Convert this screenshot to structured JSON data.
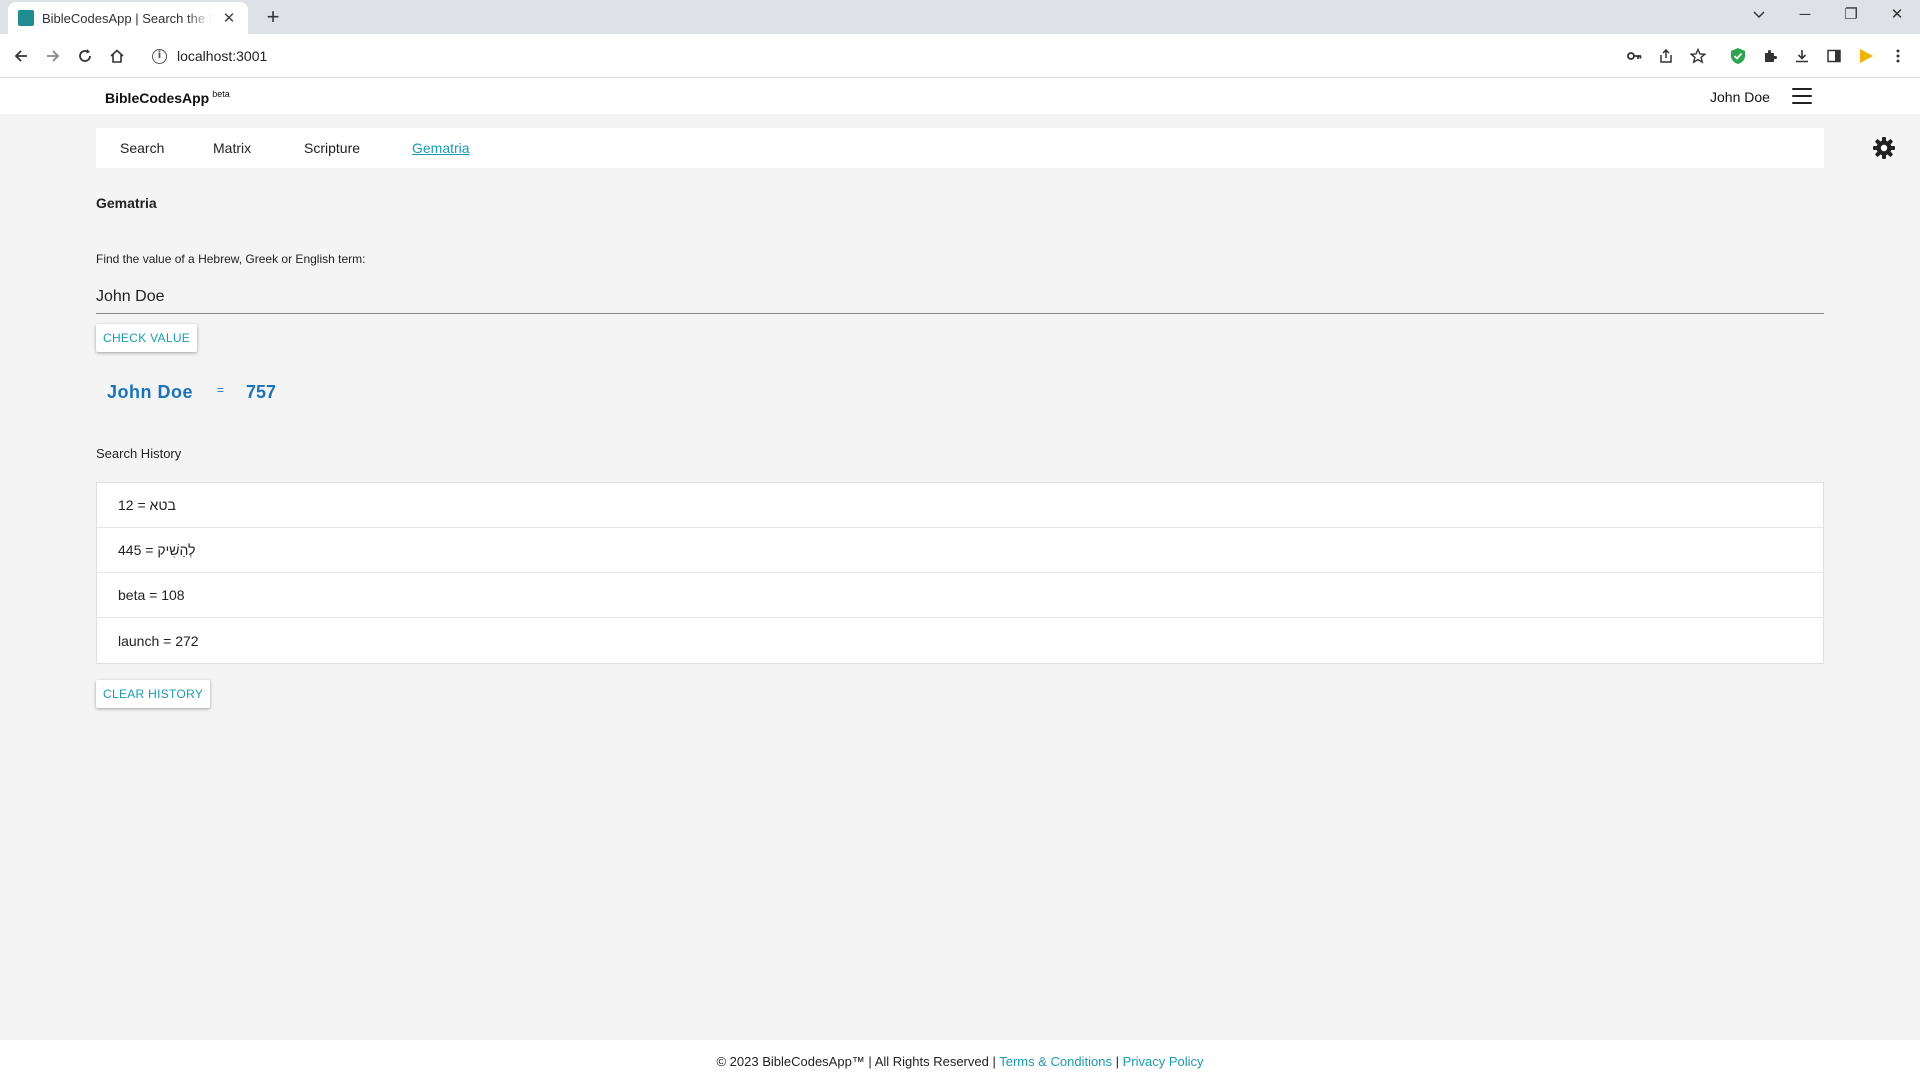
{
  "browser": {
    "tab_title": "BibleCodesApp | Search the Bible",
    "url": "localhost:3001"
  },
  "app": {
    "brand": "BibleCodesApp",
    "brand_tag": "beta",
    "user_name": "John Doe"
  },
  "nav": {
    "tabs": [
      {
        "label": "Search"
      },
      {
        "label": "Matrix"
      },
      {
        "label": "Scripture"
      },
      {
        "label": "Gematria"
      }
    ],
    "active": "Gematria"
  },
  "gematria": {
    "title": "Gematria",
    "field_label": "Find the value of a Hebrew, Greek or English term:",
    "input_value": "John Doe",
    "check_button": "CHECK VALUE",
    "result": {
      "term": "John Doe",
      "equals": "=",
      "value": "757"
    }
  },
  "history": {
    "label": "Search History",
    "items": [
      {
        "text": "12 = בטא"
      },
      {
        "text": "445 = לְהַשִׁיק"
      },
      {
        "text": "beta = 108"
      },
      {
        "text": "launch = 272"
      }
    ],
    "clear_button": "CLEAR HISTORY"
  },
  "footer": {
    "copyright": "© 2023 BibleCodesApp™ | All Rights Reserved |",
    "terms": "Terms & Conditions",
    "separator": "|",
    "privacy": "Privacy Policy"
  },
  "colors": {
    "accent": "#1a9ab0",
    "result": "#1a73b8",
    "page_bg": "#f4f4f4"
  }
}
